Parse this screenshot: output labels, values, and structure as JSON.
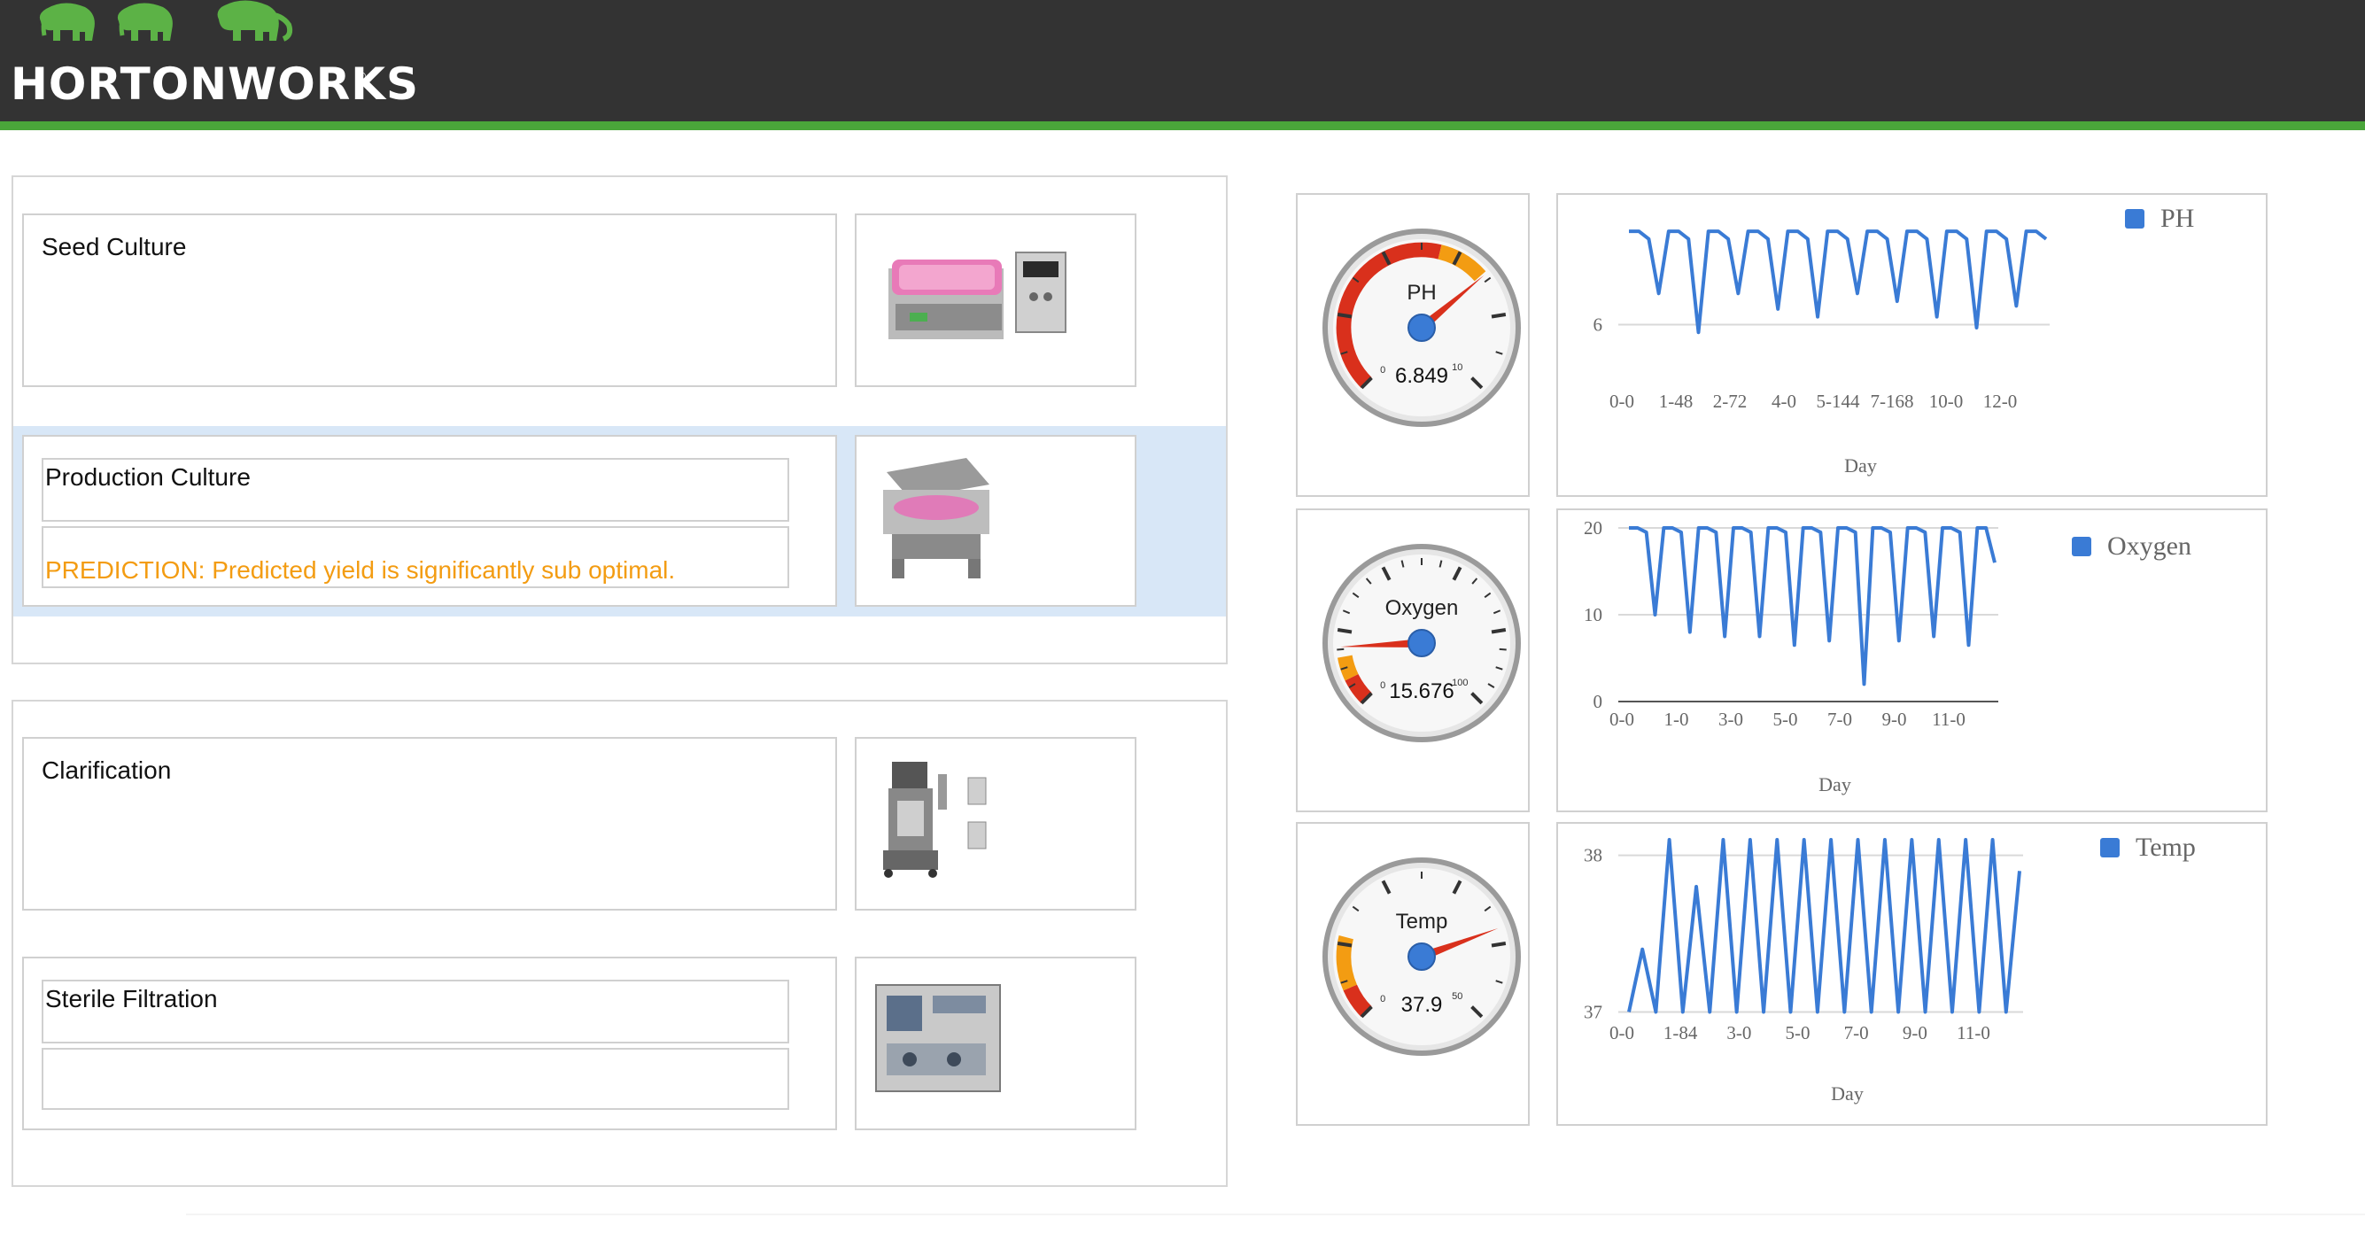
{
  "header": {
    "brand": "HORTONWORKS",
    "reg": "®",
    "bar_color": "#333333",
    "stripe_color": "#4aa53a",
    "logo_color": "#5cb246"
  },
  "stages": [
    {
      "name": "Seed Culture",
      "note": ""
    },
    {
      "name": "Production Culture",
      "note": "PREDICTION: Predicted yield is significantly sub optimal."
    },
    {
      "name": "Clarification",
      "note": ""
    },
    {
      "name": "Sterile Filtration",
      "note": ""
    }
  ],
  "prediction_color": "#f39c12",
  "gauges": [
    {
      "label": "PH",
      "value": 6.849,
      "value_text": "6.849",
      "min": 0,
      "max": 10,
      "min_text": "0",
      "max_text": "10"
    },
    {
      "label": "Oxygen",
      "value": 15.676,
      "value_text": "15.676",
      "min": 0,
      "max": 100,
      "min_text": "0",
      "max_text": "100"
    },
    {
      "label": "Temp",
      "value": 37.9,
      "value_text": "37.9",
      "min": 0,
      "max": 50,
      "min_text": "0",
      "max_text": "50"
    }
  ],
  "chart_data": [
    {
      "type": "line",
      "series": [
        {
          "name": "PH",
          "color": "#3a7bd5",
          "values": [
            6.6,
            6.6,
            6.55,
            6.2,
            6.6,
            6.6,
            6.55,
            5.95,
            6.6,
            6.6,
            6.55,
            6.2,
            6.6,
            6.6,
            6.55,
            6.1,
            6.6,
            6.6,
            6.55,
            6.05,
            6.6,
            6.6,
            6.55,
            6.2,
            6.6,
            6.6,
            6.55,
            6.15,
            6.6,
            6.6,
            6.55,
            6.05,
            6.6,
            6.6,
            6.55,
            5.98,
            6.6,
            6.6,
            6.55,
            6.12,
            6.6,
            6.6,
            6.55
          ]
        }
      ],
      "x_tick_labels": [
        "0-0",
        "1-48",
        "2-72",
        "4-0",
        "5-144",
        "7-168",
        "10-0",
        "12-0"
      ],
      "xlabel": "Day",
      "y_tick_labels": [
        "6"
      ],
      "ylim": [
        5.9,
        6.72
      ],
      "legend": "top-right"
    },
    {
      "type": "line",
      "series": [
        {
          "name": "Oxygen",
          "color": "#3a7bd5",
          "values": [
            20,
            20,
            19.5,
            10,
            20,
            20,
            19.5,
            8,
            20,
            20,
            19.5,
            7.5,
            20,
            20,
            19.5,
            7.5,
            20,
            20,
            19.5,
            6.5,
            20,
            20,
            19.5,
            7,
            20,
            20,
            19.5,
            2,
            20,
            20,
            19.5,
            7,
            20,
            20,
            19.5,
            7.5,
            20,
            20,
            19.5,
            6.5,
            20,
            20,
            16
          ]
        }
      ],
      "x_tick_labels": [
        "0-0",
        "1-0",
        "3-0",
        "5-0",
        "7-0",
        "9-0",
        "11-0"
      ],
      "xlabel": "Day",
      "y_tick_labels": [
        "0",
        "10",
        "20"
      ],
      "ylim": [
        0,
        20
      ],
      "legend": "top-right"
    },
    {
      "type": "line",
      "series": [
        {
          "name": "Temp",
          "color": "#3a7bd5",
          "values": [
            37,
            37.4,
            37,
            38.1,
            37,
            37.8,
            37,
            38.1,
            37,
            38.1,
            37,
            38.1,
            37,
            38.1,
            37,
            38.1,
            37,
            38.1,
            37,
            38.1,
            37,
            38.1,
            37,
            38.1,
            37,
            38.1,
            37,
            38.1,
            37,
            37.9
          ]
        }
      ],
      "x_tick_labels": [
        "0-0",
        "1-84",
        "3-0",
        "5-0",
        "7-0",
        "9-0",
        "11-0"
      ],
      "xlabel": "Day",
      "y_tick_labels": [
        "37",
        "38"
      ],
      "ylim": [
        36.98,
        38.1
      ],
      "legend": "top-right"
    }
  ]
}
